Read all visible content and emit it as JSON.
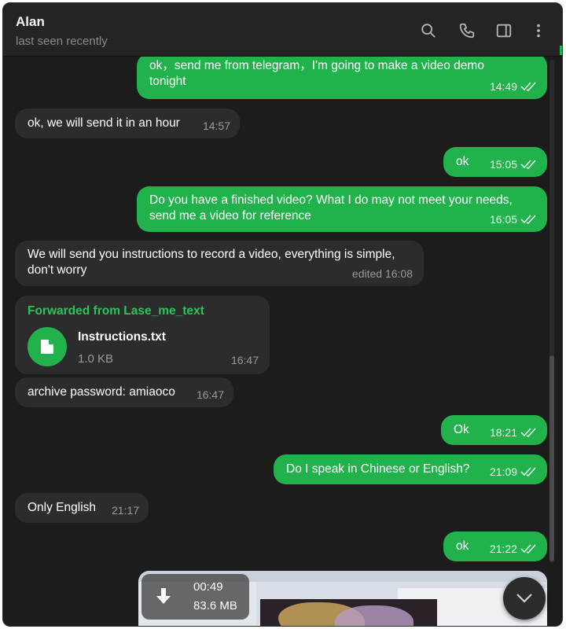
{
  "header": {
    "contact_name": "Alan",
    "status": "last seen recently"
  },
  "icons": {
    "search": "search-icon",
    "call": "phone-icon",
    "sidebar": "sidebar-toggle-icon",
    "more": "more-vertical-icon"
  },
  "colors": {
    "outgoing_bubble": "#21b24c",
    "incoming_bubble": "#2c2c2c",
    "background": "#1c1c1c",
    "accent": "#2fc259"
  },
  "messages": [
    {
      "dir": "out",
      "text": "ok，send me from telegram，I'm going to make a video demo\ntonight",
      "time": "14:49",
      "read": true
    },
    {
      "dir": "in",
      "text": "ok, we will send it in an hour",
      "time": "14:57"
    },
    {
      "dir": "out",
      "text": "ok",
      "time": "15:05",
      "read": true
    },
    {
      "dir": "out",
      "text": "Do you have a finished video? What I do may not meet your needs,\nsend me a video for reference",
      "time": "16:05",
      "read": true
    },
    {
      "dir": "in",
      "text": "We will send you instructions to record a video, everything is simple,\ndon't worry",
      "time": "edited 16:08"
    },
    {
      "dir": "in",
      "type": "file",
      "forwarded_from": "Forwarded from Lase_me_text",
      "file_name": "Instructions.txt",
      "file_size": "1.0 KB",
      "time": "16:47"
    },
    {
      "dir": "in",
      "text": "archive password: amiaoco",
      "time": "16:47"
    },
    {
      "dir": "out",
      "text": "Ok",
      "time": "18:21",
      "read": true
    },
    {
      "dir": "out",
      "text": "Do I speak in Chinese or English?",
      "time": "21:09",
      "read": true
    },
    {
      "dir": "in",
      "text": "Only English",
      "time": "21:17"
    },
    {
      "dir": "out",
      "text": "ok",
      "time": "21:22",
      "read": true
    }
  ],
  "video": {
    "duration": "00:49",
    "size": "83.6 MB"
  }
}
